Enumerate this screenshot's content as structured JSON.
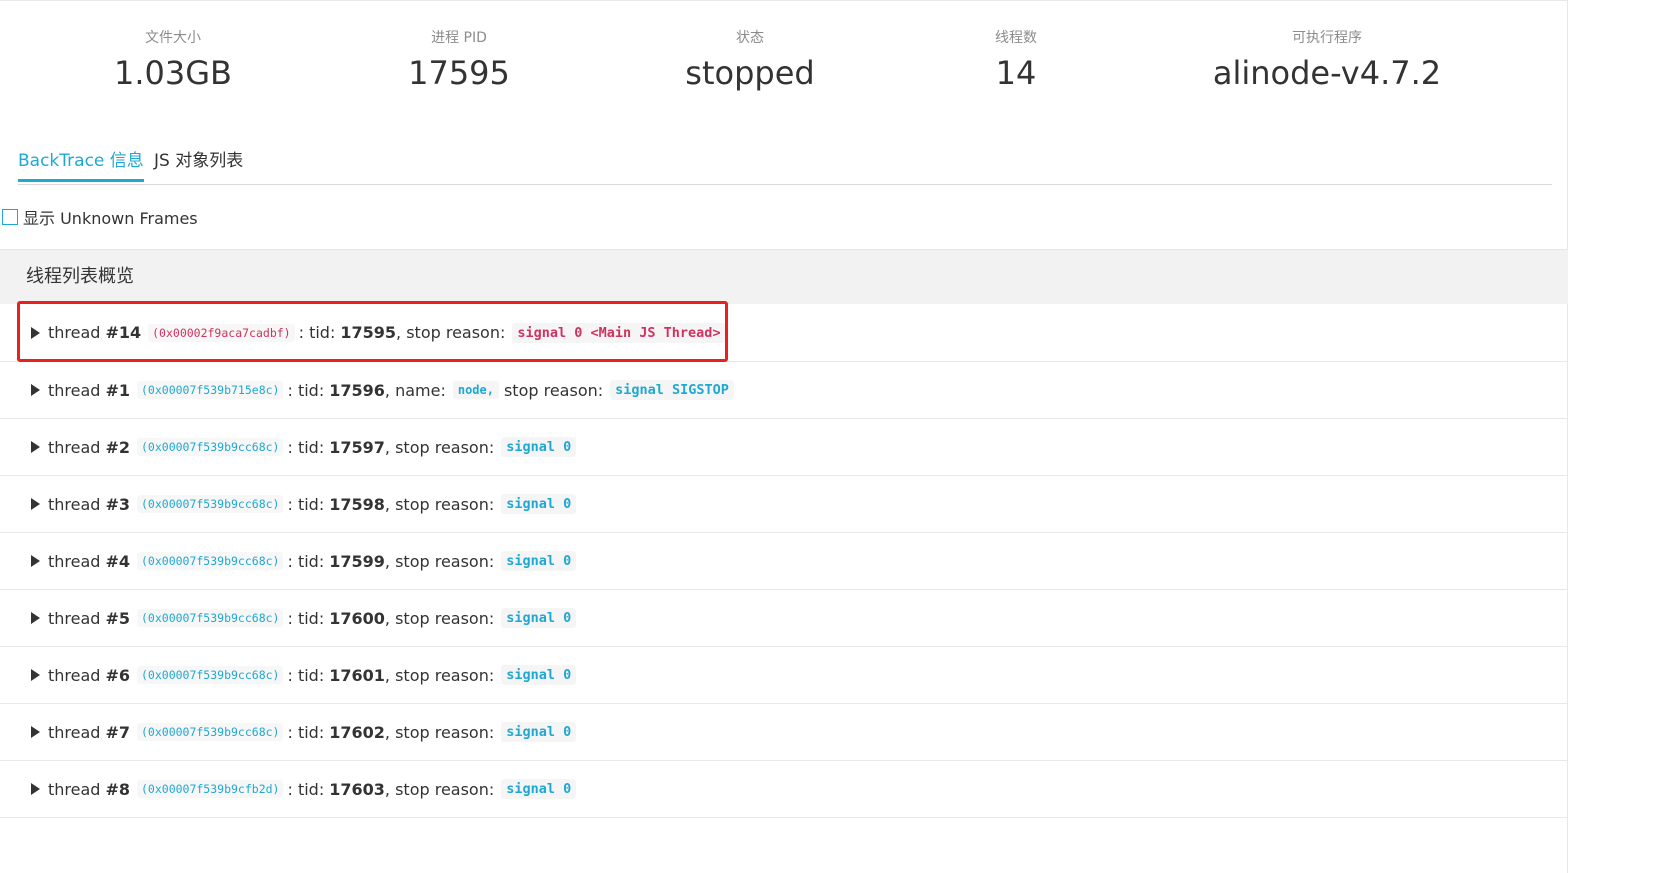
{
  "stats": [
    {
      "label": "文件大小",
      "value": "1.03GB"
    },
    {
      "label": "进程 PID",
      "value": "17595"
    },
    {
      "label": "状态",
      "value": "stopped"
    },
    {
      "label": "线程数",
      "value": "14"
    },
    {
      "label": "可执行程序",
      "value": "alinode-v4.7.2"
    }
  ],
  "tabs": {
    "backtrace": "BackTrace 信息",
    "js_objects": "JS 对象列表",
    "active": "backtrace"
  },
  "options": {
    "show_unknown_frames": "显示 Unknown Frames",
    "show_unknown_frames_checked": false
  },
  "panel": {
    "title": "线程列表概览",
    "labels": {
      "thread": "thread",
      "tid": ": tid:",
      "stop_reason": "stop reason:",
      "name": "name:"
    },
    "threads": [
      {
        "num": "#14",
        "addr": "(0x00002f9aca7cadbf)",
        "tid": "17595",
        "reason": "signal 0 <Main JS Thread>",
        "reason_color": "#d0325f",
        "highlighted": true
      },
      {
        "num": "#1",
        "addr": "(0x00007f539b715e8c)",
        "tid": "17596",
        "name": "node,",
        "reason": "signal SIGSTOP",
        "reason_color": "#1fa8d1"
      },
      {
        "num": "#2",
        "addr": "(0x00007f539b9cc68c)",
        "tid": "17597",
        "reason": "signal 0",
        "reason_color": "#1fa8d1"
      },
      {
        "num": "#3",
        "addr": "(0x00007f539b9cc68c)",
        "tid": "17598",
        "reason": "signal 0",
        "reason_color": "#1fa8d1"
      },
      {
        "num": "#4",
        "addr": "(0x00007f539b9cc68c)",
        "tid": "17599",
        "reason": "signal 0",
        "reason_color": "#1fa8d1"
      },
      {
        "num": "#5",
        "addr": "(0x00007f539b9cc68c)",
        "tid": "17600",
        "reason": "signal 0",
        "reason_color": "#1fa8d1"
      },
      {
        "num": "#6",
        "addr": "(0x00007f539b9cc68c)",
        "tid": "17601",
        "reason": "signal 0",
        "reason_color": "#1fa8d1"
      },
      {
        "num": "#7",
        "addr": "(0x00007f539b9cc68c)",
        "tid": "17602",
        "reason": "signal 0",
        "reason_color": "#1fa8d1"
      },
      {
        "num": "#8",
        "addr": "(0x00007f539b9cfb2d)",
        "tid": "17603",
        "reason": "signal 0",
        "reason_color": "#1fa8d1"
      }
    ]
  },
  "colors": {
    "accent": "#1fa8d1",
    "highlight_border": "#e8211b",
    "main_thread": "#d0325f"
  }
}
